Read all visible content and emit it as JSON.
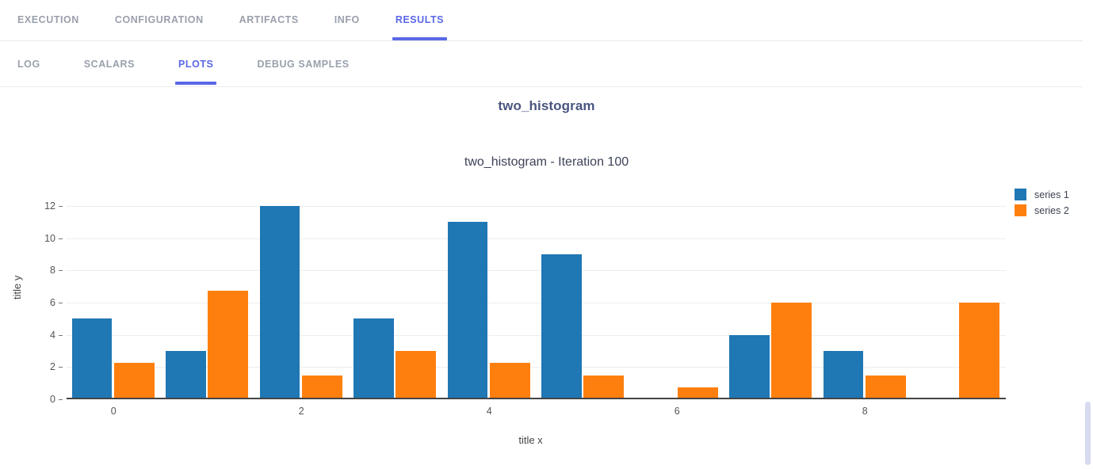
{
  "main_tabs": [
    {
      "label": "EXECUTION",
      "active": false
    },
    {
      "label": "CONFIGURATION",
      "active": false
    },
    {
      "label": "ARTIFACTS",
      "active": false
    },
    {
      "label": "INFO",
      "active": false
    },
    {
      "label": "RESULTS",
      "active": true
    }
  ],
  "sub_tabs": [
    {
      "label": "LOG",
      "active": false
    },
    {
      "label": "SCALARS",
      "active": false
    },
    {
      "label": "PLOTS",
      "active": true
    },
    {
      "label": "DEBUG SAMPLES",
      "active": false
    }
  ],
  "panel": {
    "header_title": "two_histogram"
  },
  "colors": {
    "accent": "#5a68e8",
    "series1": "#1f77b4",
    "series2": "#ff7f0e",
    "scrollbar_thumb": "#d6dbef"
  },
  "chart_data": {
    "type": "bar",
    "title": "two_histogram - Iteration 100",
    "xlabel": "title x",
    "ylabel": "title y",
    "categories": [
      0,
      1,
      2,
      3,
      4,
      5,
      6,
      7,
      8,
      9
    ],
    "xticks": [
      0,
      2,
      4,
      6,
      8
    ],
    "yticks": [
      0,
      2,
      4,
      6,
      8,
      10,
      12
    ],
    "ylim": [
      0,
      12.5
    ],
    "grid": true,
    "legend_position": "right",
    "series": [
      {
        "name": "series 1",
        "color": "#1f77b4",
        "values": [
          5,
          3,
          12,
          5,
          11,
          9,
          0,
          4,
          3,
          0
        ]
      },
      {
        "name": "series 2",
        "color": "#ff7f0e",
        "values": [
          2.25,
          6.75,
          1.5,
          3,
          2.25,
          1.5,
          0.75,
          6,
          1.5,
          6
        ]
      }
    ]
  },
  "scrollbar": {
    "visible": true
  }
}
